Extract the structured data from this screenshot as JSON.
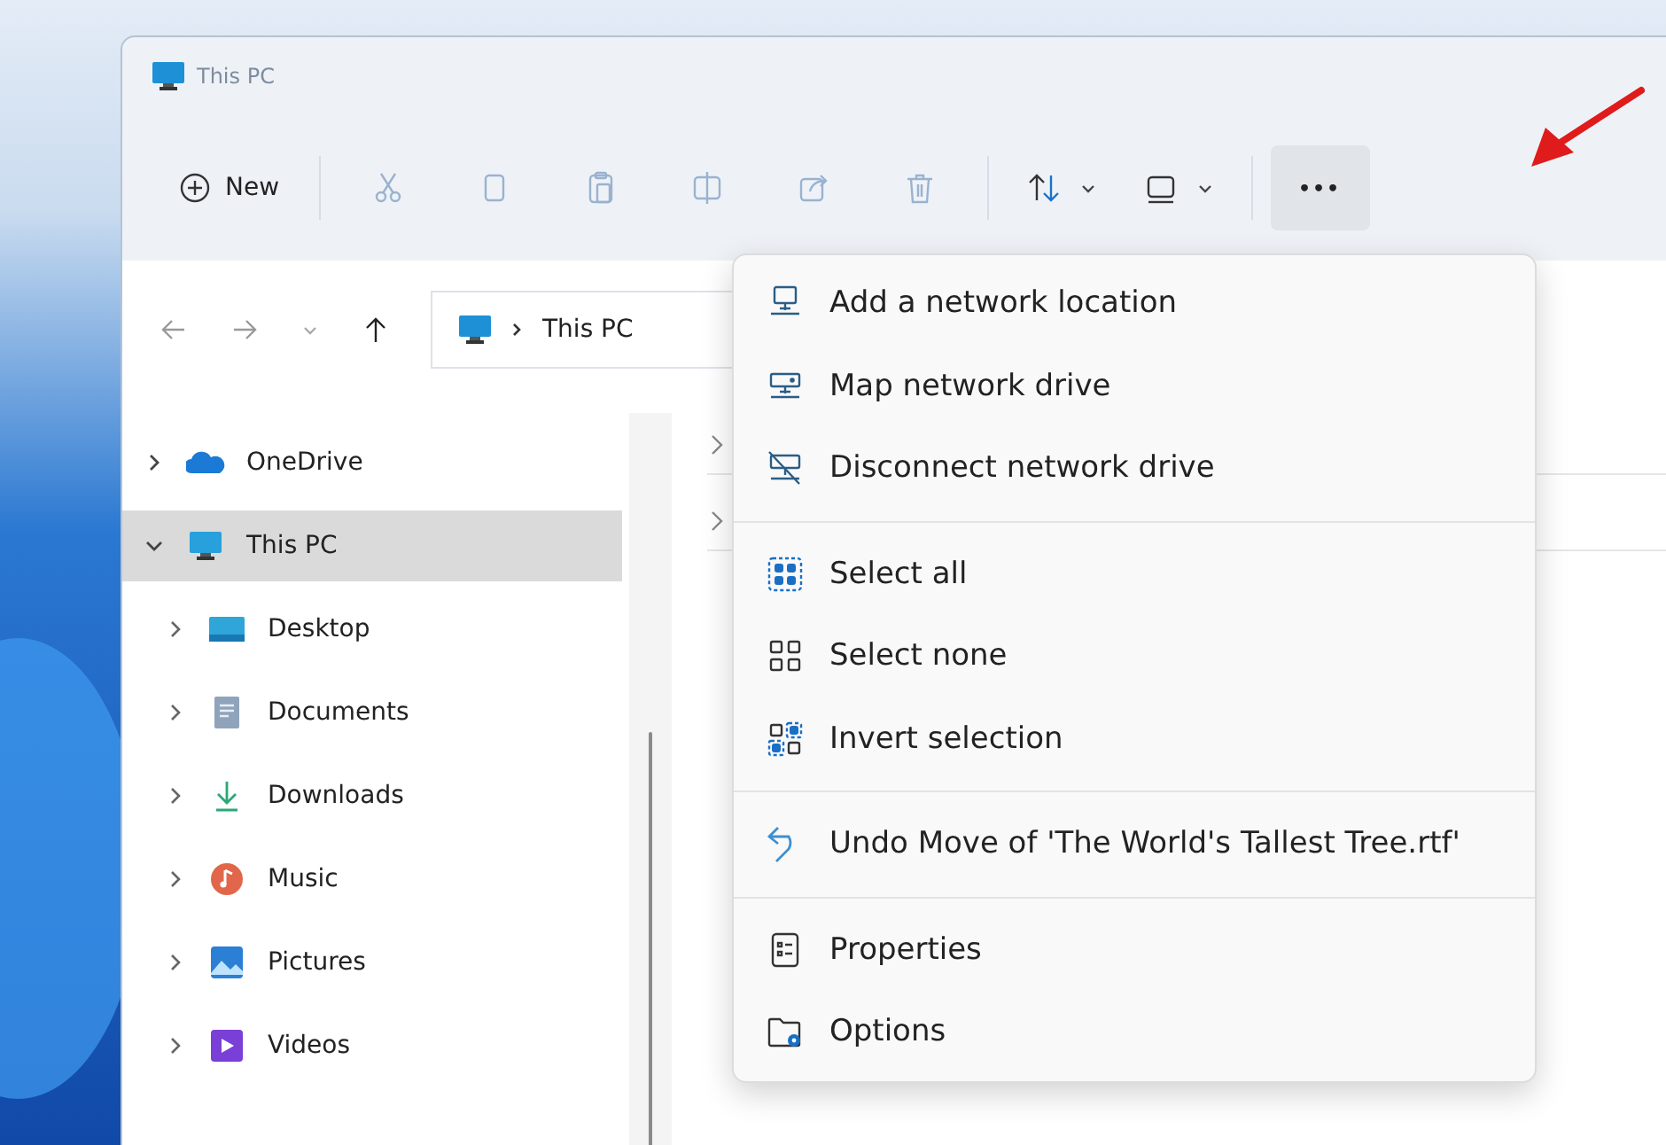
{
  "window": {
    "title": "This PC"
  },
  "toolbar": {
    "new_button": {
      "label": "New"
    },
    "buttons": [
      {
        "kind": "cut",
        "disabled": true
      },
      {
        "kind": "copy",
        "disabled": true
      },
      {
        "kind": "paste",
        "disabled": true
      },
      {
        "kind": "rename",
        "disabled": true
      },
      {
        "kind": "share",
        "disabled": true
      },
      {
        "kind": "delete",
        "disabled": true
      },
      {
        "kind": "sort",
        "disabled": false
      },
      {
        "kind": "view",
        "disabled": false
      }
    ],
    "more_button": {
      "label": "•••",
      "selected": true
    }
  },
  "navigation": {
    "back_disabled": true,
    "forward_disabled": true,
    "address": [
      "This PC"
    ]
  },
  "sidebar": {
    "items": [
      {
        "label": "OneDrive",
        "expanded": false,
        "selected": false
      },
      {
        "label": "This PC",
        "expanded": true,
        "selected": true,
        "children": [
          {
            "label": "Desktop",
            "expanded": false,
            "selected": false
          },
          {
            "label": "Documents",
            "expanded": false,
            "selected": false
          },
          {
            "label": "Downloads",
            "expanded": false,
            "selected": false
          },
          {
            "label": "Music",
            "expanded": false,
            "selected": false
          },
          {
            "label": "Pictures",
            "expanded": false,
            "selected": false
          },
          {
            "label": "Videos",
            "expanded": false,
            "selected": false
          }
        ]
      }
    ]
  },
  "content": {
    "groups": [
      {
        "expanded": false
      },
      {
        "expanded": false
      }
    ]
  },
  "menu": {
    "sections": [
      [
        {
          "label": "Add a network location"
        },
        {
          "label": "Map network drive"
        },
        {
          "label": "Disconnect network drive"
        }
      ],
      [
        {
          "label": "Select all"
        },
        {
          "label": "Select none"
        },
        {
          "label": "Invert selection"
        }
      ],
      [
        {
          "label": "Undo Move of 'The World's Tallest Tree.rtf'"
        }
      ],
      [
        {
          "label": "Properties"
        },
        {
          "label": "Options"
        }
      ]
    ]
  },
  "annotation": {
    "kind": "arrow"
  }
}
